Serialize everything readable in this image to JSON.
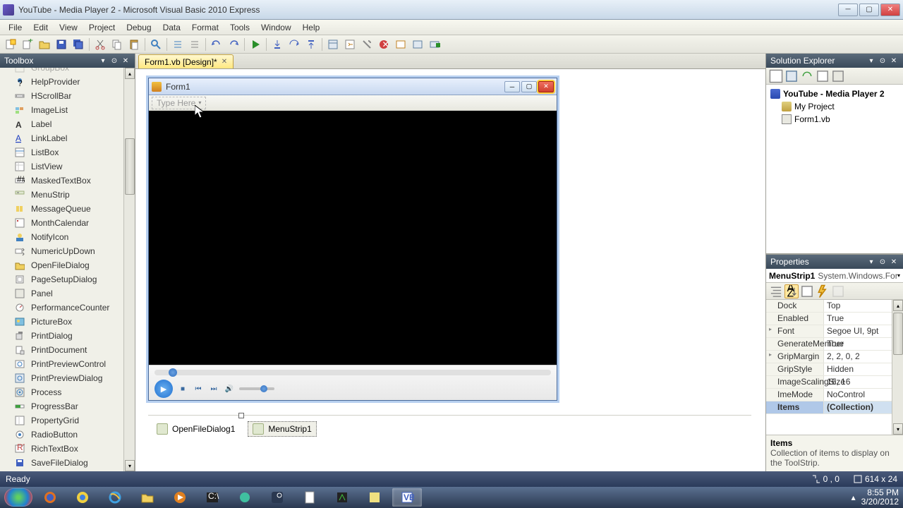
{
  "window": {
    "title": "YouTube - Media Player 2 - Microsoft Visual Basic 2010 Express"
  },
  "menubar": [
    "File",
    "Edit",
    "View",
    "Project",
    "Debug",
    "Data",
    "Format",
    "Tools",
    "Window",
    "Help"
  ],
  "tab": {
    "label": "Form1.vb [Design]*"
  },
  "toolbox": {
    "title": "Toolbox",
    "items": [
      "GroupBox",
      "HelpProvider",
      "HScrollBar",
      "ImageList",
      "Label",
      "LinkLabel",
      "ListBox",
      "ListView",
      "MaskedTextBox",
      "MenuStrip",
      "MessageQueue",
      "MonthCalendar",
      "NotifyIcon",
      "NumericUpDown",
      "OpenFileDialog",
      "PageSetupDialog",
      "Panel",
      "PerformanceCounter",
      "PictureBox",
      "PrintDialog",
      "PrintDocument",
      "PrintPreviewControl",
      "PrintPreviewDialog",
      "Process",
      "ProgressBar",
      "PropertyGrid",
      "RadioButton",
      "RichTextBox",
      "SaveFileDialog"
    ]
  },
  "form1": {
    "title": "Form1",
    "typehere": "Type Here"
  },
  "tray": {
    "item1": "OpenFileDialog1",
    "item2": "MenuStrip1"
  },
  "solution_explorer": {
    "title": "Solution Explorer",
    "root": "YouTube - Media Player 2",
    "items": [
      "My Project",
      "Form1.vb"
    ]
  },
  "properties": {
    "title": "Properties",
    "object_name": "MenuStrip1",
    "object_type": "System.Windows.Forms.MenuStrip",
    "rows": [
      {
        "name": "Dock",
        "val": "Top"
      },
      {
        "name": "Enabled",
        "val": "True"
      },
      {
        "name": "Font",
        "val": "Segoe UI, 9pt",
        "exp": true
      },
      {
        "name": "GenerateMember",
        "val": "True"
      },
      {
        "name": "GripMargin",
        "val": "2, 2, 0, 2",
        "exp": true
      },
      {
        "name": "GripStyle",
        "val": "Hidden"
      },
      {
        "name": "ImageScalingSize",
        "val": "16, 16"
      },
      {
        "name": "ImeMode",
        "val": "NoControl"
      },
      {
        "name": "Items",
        "val": "(Collection)",
        "selected": true
      }
    ],
    "desc_title": "Items",
    "desc_text": "Collection of items to display on the ToolStrip."
  },
  "statusbar": {
    "ready": "Ready",
    "pos": "0 , 0",
    "size": "614 x 24"
  },
  "taskbar": {
    "time": "8:55 PM",
    "date": "3/20/2012"
  }
}
